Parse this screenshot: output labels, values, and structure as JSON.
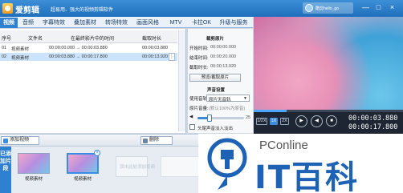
{
  "app": {
    "title": "爱剪辑",
    "slogan": "超易用、强大的视频剪辑软件",
    "user_name": "酷剪hello_go"
  },
  "tabs": [
    "视频",
    "音频",
    "字幕特效",
    "叠加素材",
    "转场特效",
    "画面风格",
    "MTV",
    "卡拉OK",
    "升级与服务"
  ],
  "file_list": {
    "columns": [
      "序号",
      "文件名",
      "在最终影片中的时间",
      "截取时长"
    ],
    "rows": [
      {
        "num": "01",
        "name": "视频素材",
        "time": "00:00:00.000 → 00:00:03.880",
        "duration": "00:00:03.880"
      },
      {
        "num": "02",
        "name": "视频素材",
        "time": "00:00:03.880 → 00:00:17.800",
        "duration": "00:00:13.920"
      }
    ],
    "row_menu": "⋮"
  },
  "settings": {
    "title": "裁剪原片",
    "start_label": "开始时间:",
    "start_value": "00:00:00.000",
    "end_label": "结束时间:",
    "end_value": "00:00:20.000",
    "duration_label": "截取时长:",
    "duration_value": "00:00:13.920",
    "preview_button": "预览/截取原片",
    "audio_title": "声音设置",
    "track_label": "使用音轨:",
    "track_value": "原片无音轨",
    "volume_label": "原片音量:",
    "volume_hint": "(默认100%为原音)",
    "volume_value": "25",
    "fade_label": "头尾声音淡入淡出"
  },
  "player": {
    "speeds": [
      "1/2X",
      "1X",
      "2X"
    ],
    "active_speed": "1X",
    "current_time": "00:00:03.880",
    "total_time": "00:00:17.800",
    "progress": 0.22,
    "play_icon": "▶",
    "prev_icon": "◀"
  },
  "toolbar": {
    "add_label": "添加视频",
    "delete_label": "删除"
  },
  "timeline": {
    "label": "已添加片段",
    "clips": [
      {
        "label": "视频素材"
      },
      {
        "label": "视频素材"
      }
    ],
    "placeholder": "双击此处添加视频",
    "close_icon": "×"
  },
  "window": {
    "minimize": "—",
    "maximize": "□",
    "close": "×"
  },
  "watermark": {
    "site": "PConline",
    "brand": "IT百科"
  },
  "colors": {
    "accent": "#2f80d1",
    "titlebar": "#1f6fbc",
    "brand_blue": "#1d62b4"
  }
}
